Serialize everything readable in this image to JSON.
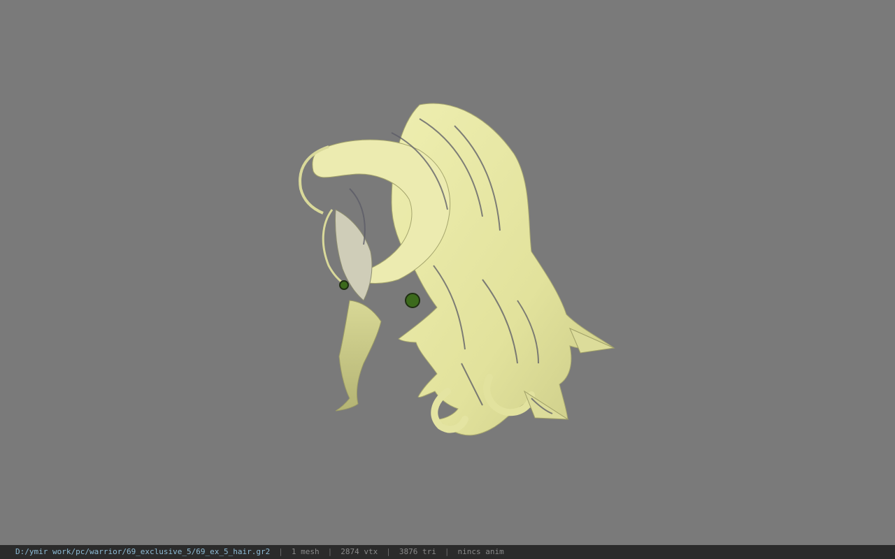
{
  "viewer": {
    "background_color": "#7a7a7a",
    "model_icon": "hair-model-icon",
    "hair_color": "#e6e6a4",
    "hair_shadow_color": "#b8b878",
    "strand_stripe_color": "#5a5a66",
    "eye_color": "#3c6a1c"
  },
  "status": {
    "file_path": "D:/ymir work/pc/warrior/69_exclusive_5/69_ex_5_hair.gr2",
    "separator": "|",
    "mesh_count": "1 mesh",
    "vertex_count": "2874 vtx",
    "triangle_count": "3876 tri",
    "anim": "nincs anim"
  }
}
